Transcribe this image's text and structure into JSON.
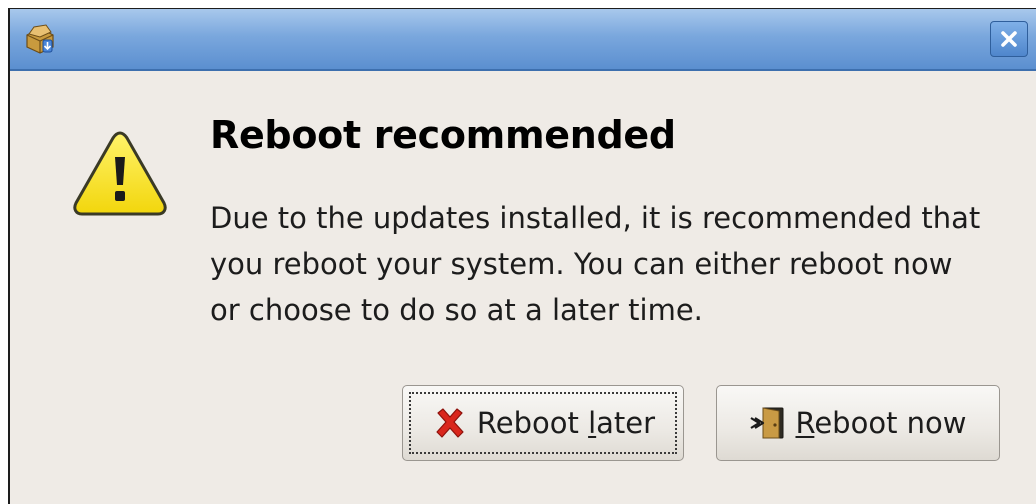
{
  "dialog": {
    "heading": "Reboot recommended",
    "message_lines": [
      "Due to the updates installed, it is recommended that",
      "you reboot your system.  You can either reboot now",
      "or choose to do so at a later time."
    ]
  },
  "titlebar": {
    "app_icon": "software-update-icon",
    "close_icon": "close-icon"
  },
  "buttons": {
    "later": {
      "label_pre": "Reboot ",
      "label_mnemonic": "l",
      "label_post": "ater",
      "icon": "red-x-icon",
      "focused": true
    },
    "now": {
      "label_pre": "",
      "label_mnemonic": "R",
      "label_post": "eboot now",
      "icon": "reboot-icon"
    }
  },
  "colors": {
    "titlebar": "#5b8fd0",
    "window_bg": "#efebe6",
    "warning_fill": "#f6e21e",
    "cancel_red": "#d9261c"
  }
}
